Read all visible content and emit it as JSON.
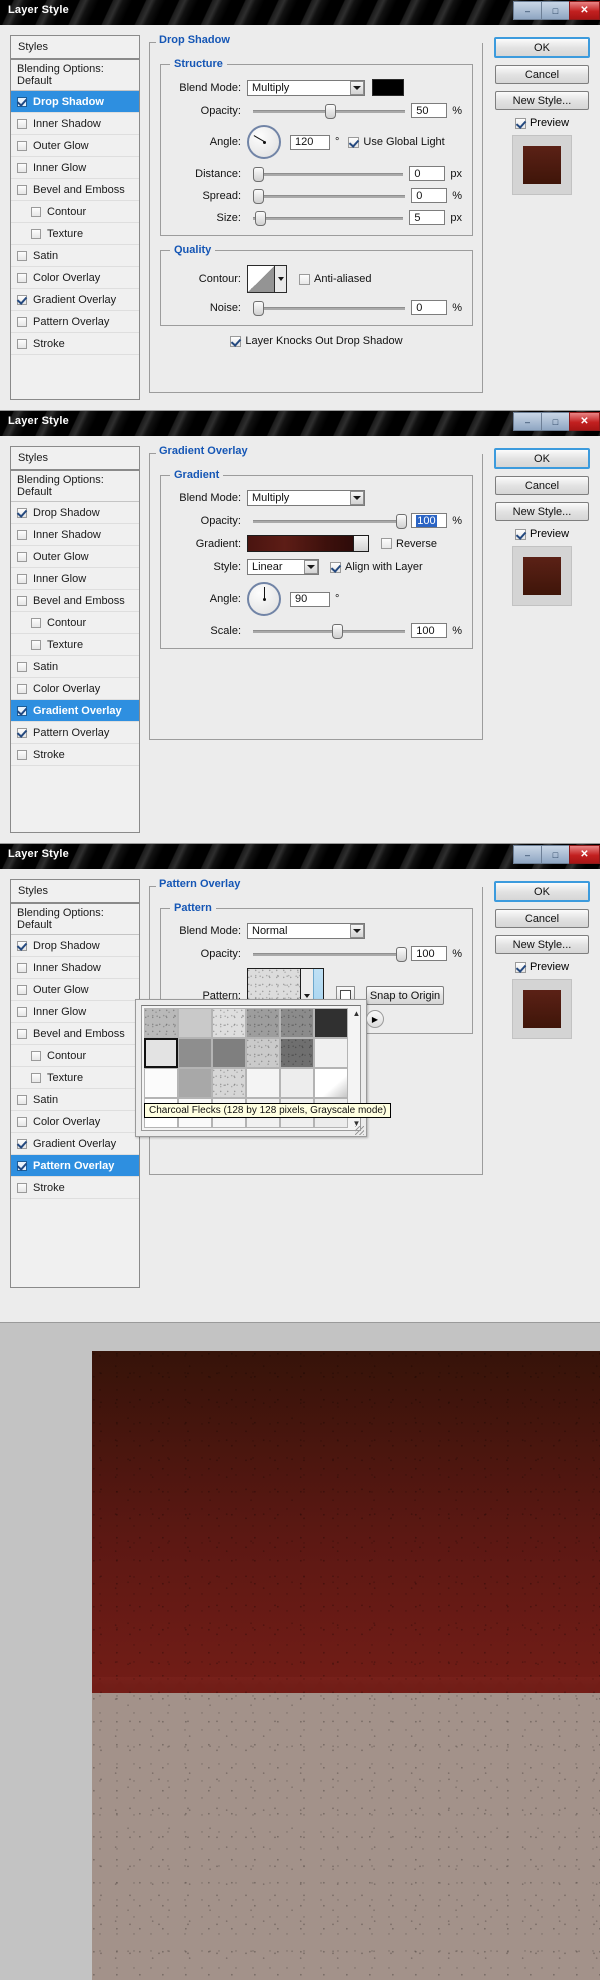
{
  "window": {
    "title": "Layer Style",
    "buttons": {
      "minimize": "–",
      "maximize": "□",
      "close": "✕"
    }
  },
  "styles_panel": {
    "header": "Styles",
    "blending": "Blending Options: Default",
    "items": [
      {
        "label": "Drop Shadow",
        "checked": true
      },
      {
        "label": "Inner Shadow",
        "checked": false
      },
      {
        "label": "Outer Glow",
        "checked": false
      },
      {
        "label": "Inner Glow",
        "checked": false
      },
      {
        "label": "Bevel and Emboss",
        "checked": false
      },
      {
        "label": "Contour",
        "checked": false,
        "sub": true
      },
      {
        "label": "Texture",
        "checked": false,
        "sub": true
      },
      {
        "label": "Satin",
        "checked": false
      },
      {
        "label": "Color Overlay",
        "checked": false
      },
      {
        "label": "Gradient Overlay",
        "checked": true
      },
      {
        "label": "Pattern Overlay",
        "checked": false
      },
      {
        "label": "Stroke",
        "checked": false
      }
    ]
  },
  "buttons": {
    "ok": "OK",
    "cancel": "Cancel",
    "new_style": "New Style...",
    "preview": "Preview"
  },
  "dialog1": {
    "section_title": "Drop Shadow",
    "group_title": "Structure",
    "quality_title": "Quality",
    "blend_mode_label": "Blend Mode:",
    "blend_mode_value": "Multiply",
    "opacity_label": "Opacity:",
    "opacity_value": "50",
    "opacity_unit": "%",
    "angle_label": "Angle:",
    "angle_value": "120",
    "angle_unit": "°",
    "use_global_light": "Use Global Light",
    "distance_label": "Distance:",
    "distance_value": "0",
    "distance_unit": "px",
    "spread_label": "Spread:",
    "spread_value": "0",
    "spread_unit": "%",
    "size_label": "Size:",
    "size_value": "5",
    "size_unit": "px",
    "contour_label": "Contour:",
    "anti_aliased": "Anti-aliased",
    "noise_label": "Noise:",
    "noise_value": "0",
    "noise_unit": "%",
    "knockout": "Layer Knocks Out Drop Shadow",
    "selected_style": "Drop Shadow",
    "shadow_color": "#000000"
  },
  "dialog2": {
    "section_title": "Gradient Overlay",
    "group_title": "Gradient",
    "blend_mode_label": "Blend Mode:",
    "blend_mode_value": "Multiply",
    "opacity_label": "Opacity:",
    "opacity_value": "100",
    "opacity_unit": "%",
    "gradient_label": "Gradient:",
    "reverse": "Reverse",
    "style_label": "Style:",
    "style_value": "Linear",
    "align_with_layer": "Align with Layer",
    "angle_label": "Angle:",
    "angle_value": "90",
    "angle_unit": "°",
    "scale_label": "Scale:",
    "scale_value": "100",
    "scale_unit": "%",
    "selected_style": "Gradient Overlay",
    "gradient_colors": [
      "#4a1410",
      "#5d1d16",
      "#2e0b09"
    ]
  },
  "dialog3": {
    "section_title": "Pattern Overlay",
    "group_title": "Pattern",
    "blend_mode_label": "Blend Mode:",
    "blend_mode_value": "Normal",
    "opacity_label": "Opacity:",
    "opacity_value": "100",
    "opacity_unit": "%",
    "pattern_label": "Pattern:",
    "snap_to_origin": "Snap to Origin",
    "selected_style": "Pattern Overlay",
    "picker": {
      "tooltip": "Charcoal Flecks (128 by 128 pixels, Grayscale mode)",
      "menu_icon": "picker-menu-icon",
      "swatches": [
        "#b9b9b9",
        "#c9c9c9",
        "#dedede",
        "#9d9d9d",
        "#8b8b8b",
        "#303030",
        "#e3e3e3",
        "#8e8e8e",
        "#7f7f7f",
        "#cacaca",
        "#6f6f6f",
        "#f0f0f0",
        "#fbfbfb",
        "#a8a8a8",
        "#d6d6d6",
        "#f4f4f4",
        "#ededed",
        "#e9e9e9",
        "#ffffff",
        "#fafafa",
        "#f6f6f6",
        "#f1f1f1",
        "#efefef",
        "#ececec"
      ],
      "selected_index": 6
    }
  },
  "artwork": {
    "canvas_bg": "#a3928a",
    "top_color": "#5c1813",
    "bottom_color": "#a3928a",
    "desk_color": "#c3c3c3"
  }
}
